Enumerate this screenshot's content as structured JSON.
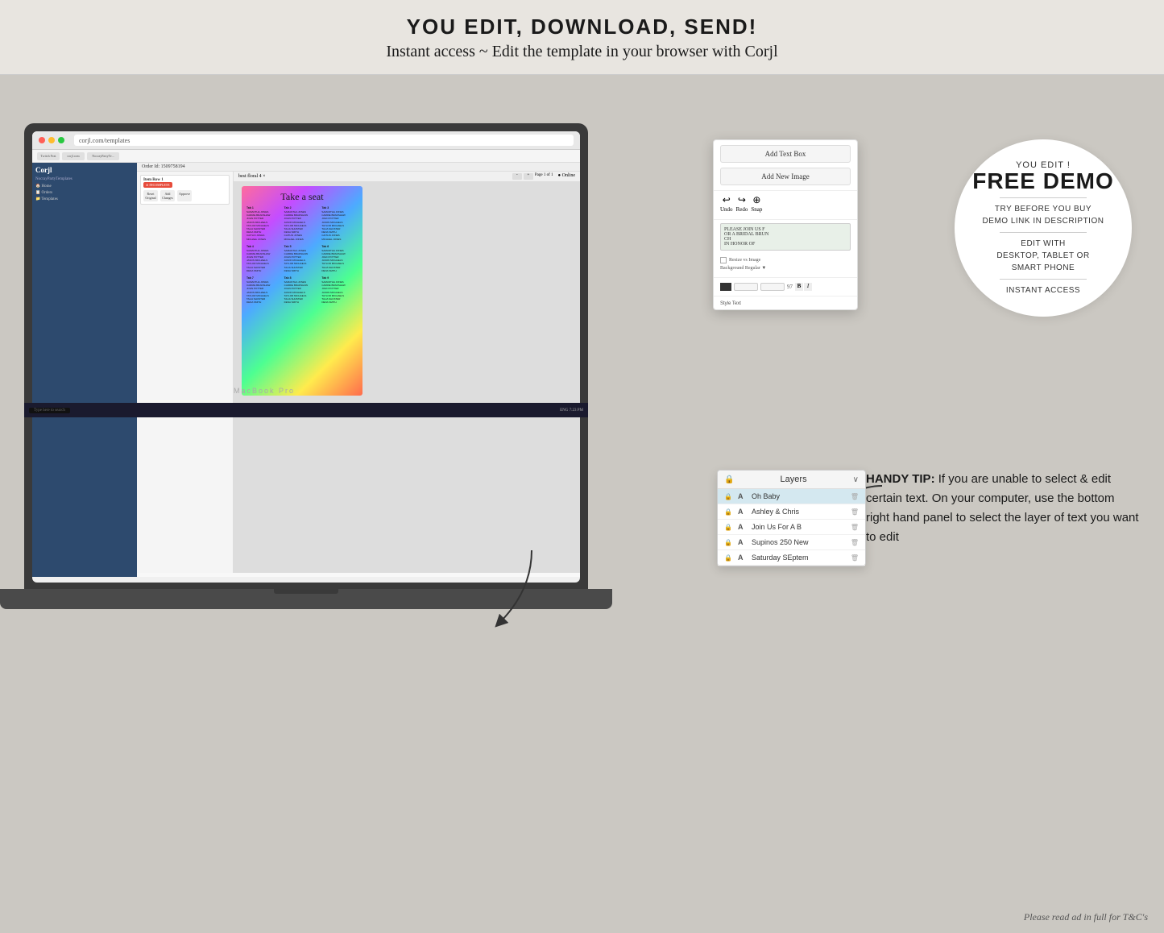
{
  "header": {
    "line1": "YOU EDIT, DOWNLOAD, SEND!",
    "line2": "Instant access ~ Edit the template in your browser with Corjl"
  },
  "demo_circle": {
    "you_edit": "YOU EDIT !",
    "free_demo": "FREE DEMO",
    "try_before": "TRY BEFORE YOU BUY",
    "demo_link": "DEMO LINK IN DESCRIPTION",
    "edit_with": "EDIT WITH",
    "devices": "DESKTOP, TABLET OR",
    "smart_phone": "SMART PHONE",
    "instant_access": "INSTANT ACCESS"
  },
  "floating_panel": {
    "add_text_box": "Add Text Box",
    "add_new_image": "Add New Image",
    "undo_label": "Undo",
    "redo_label": "Redo",
    "snap_label": "Snap",
    "text_content": "PLEASE JOIN US F\nOR A BRIDAL BRUN\nCH\nIN HONOR OF",
    "resize_image": "Resize vs Image",
    "background_regular": "Background Regular",
    "style_text": "Style Text"
  },
  "layers_panel": {
    "title": "Layers",
    "chevron": "∨",
    "items": [
      {
        "name": "Oh Baby",
        "selected": true
      },
      {
        "name": "Ashley & Chris",
        "selected": false
      },
      {
        "name": "Join Us For A B",
        "selected": false
      },
      {
        "name": "Supinos 250 New",
        "selected": false
      },
      {
        "name": "Saturday SEptem",
        "selected": false
      }
    ]
  },
  "handy_tip": {
    "label": "HANDY TIP:",
    "text": "If you are unable to select & edit certain text. On your computer, use the bottom right hand panel to select the layer of text you want to edit"
  },
  "seating_chart": {
    "title": "Take a seat",
    "tables": [
      {
        "label": "Tab 1",
        "guests": [
          "SAMANTHA JONES",
          "CARRIE BRADSHAW",
          "JOHN POTTER",
          "JASON MICHAELS",
          "TAYLOR MICHAELS",
          "TALIA SHUSTER",
          "DENA SMITH",
          "CAITLIN JONES",
          "MICHAEL JONES"
        ]
      },
      {
        "label": "Tab 2",
        "guests": [
          "SAMANTHA JONES",
          "CARRIE BRADSHAW",
          "JOHN POTTER",
          "JASON MICHAELS",
          "TAYLOR MICHAELS",
          "TALIA SHUSTER",
          "DENA SMITH",
          "CAITLIN JONES",
          "MICHAEL JONES"
        ]
      },
      {
        "label": "Tab 3",
        "guests": [
          "SAMANTHA JONES",
          "CARRIE BRADSHAW",
          "JOHN POTTER",
          "JASON MICHAELS",
          "TAYLOR MICHAELS",
          "TALIA SHUSTER",
          "DENA SMITH",
          "CAITLIN JONES",
          "MICHAEL JONES"
        ]
      }
    ]
  },
  "browser": {
    "url": "corjl.com/templates",
    "logo": "Corjl"
  },
  "bottom_note": "Please read ad in full for T&C's",
  "macbook_label": "MacBook Pro",
  "taskbar": {
    "items": [
      "Type here to...",
      "ENG  7:23 PM\n6/18/2019"
    ]
  }
}
